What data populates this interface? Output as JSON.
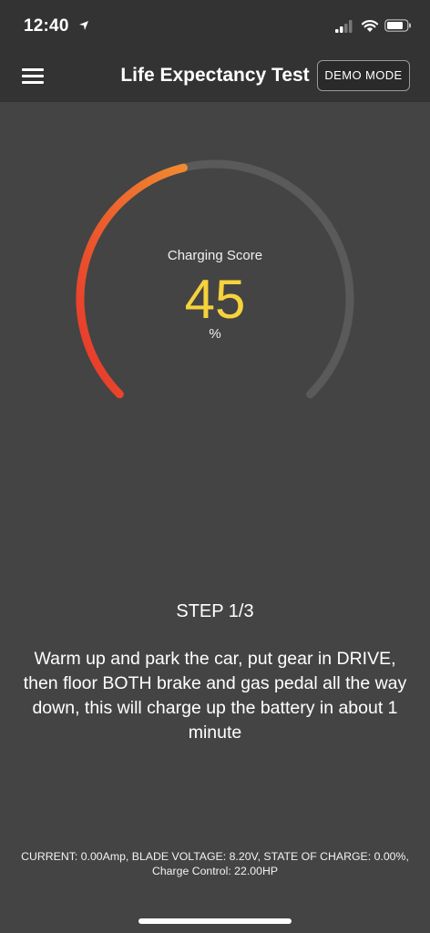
{
  "status_bar": {
    "time": "12:40",
    "icons": [
      "location-arrow-icon",
      "cellular-signal-icon",
      "wifi-icon",
      "battery-icon"
    ]
  },
  "nav": {
    "title": "Life Expectancy Test",
    "demo_button": "DEMO MODE",
    "menu_icon": "hamburger-menu-icon"
  },
  "gauge": {
    "label": "Charging Score",
    "value": "45",
    "unit": "%",
    "fraction": 0.45,
    "colors": {
      "track": "#5a5a5a",
      "start": "#e8332a",
      "end": "#f08a30"
    }
  },
  "step": {
    "title": "STEP 1/3",
    "instruction": "Warm up and park the car, put gear in DRIVE, then floor BOTH brake and gas pedal all the way down, this will charge up the battery in about 1 minute"
  },
  "telemetry": "CURRENT: 0.00Amp, BLADE VOLTAGE: 8.20V, STATE OF CHARGE: 0.00%, Charge Control: 22.00HP",
  "colors": {
    "background": "#444444",
    "bar": "#333333",
    "score": "#f6d23c"
  }
}
